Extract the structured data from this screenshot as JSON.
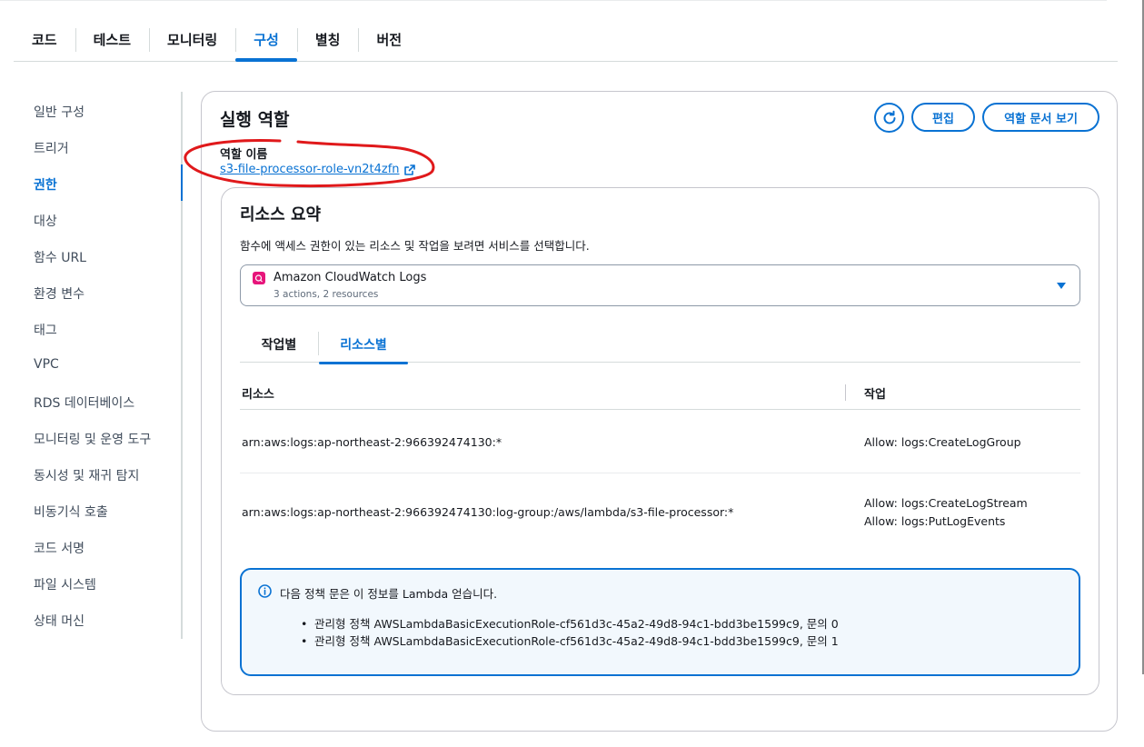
{
  "top_tabs": [
    {
      "label": "코드"
    },
    {
      "label": "테스트"
    },
    {
      "label": "모니터링"
    },
    {
      "label": "구성",
      "active": true
    },
    {
      "label": "별칭"
    },
    {
      "label": "버전"
    }
  ],
  "sidenav": {
    "items": [
      {
        "label": "일반 구성"
      },
      {
        "label": "트리거"
      },
      {
        "label": "권한",
        "active": true
      },
      {
        "label": "대상"
      },
      {
        "label": "함수 URL"
      },
      {
        "label": "환경 변수"
      },
      {
        "label": "태그"
      },
      {
        "label": "VPC"
      },
      {
        "label": "RDS 데이터베이스"
      },
      {
        "label": "모니터링 및 운영 도구"
      },
      {
        "label": "동시성 및 재귀 탐지"
      },
      {
        "label": "비동기식 호출"
      },
      {
        "label": "코드 서명"
      },
      {
        "label": "파일 시스템"
      },
      {
        "label": "상태 머신"
      }
    ]
  },
  "exec_role": {
    "title": "실행 역할",
    "edit_label": "편집",
    "view_doc_label": "역할 문서 보기",
    "role_name_label": "역할 이름",
    "role_name": "s3-file-processor-role-vn2t4zfn"
  },
  "resource_summary": {
    "title": "리소스 요약",
    "description": "함수에 액세스 권한이 있는 리소스 및 작업을 보려면 서비스를 선택합니다.",
    "service": {
      "name": "Amazon CloudWatch Logs",
      "sub": "3 actions, 2 resources"
    },
    "tabs": [
      {
        "label": "작업별"
      },
      {
        "label": "리소스별",
        "active": true
      }
    ],
    "table": {
      "headers": {
        "resource": "리소스",
        "action": "작업"
      },
      "rows": [
        {
          "resource": "arn:aws:logs:ap-northeast-2:966392474130:*",
          "actions": [
            "Allow: logs:CreateLogGroup"
          ]
        },
        {
          "resource": "arn:aws:logs:ap-northeast-2:966392474130:log-group:/aws/lambda/s3-file-processor:*",
          "actions": [
            "Allow: logs:CreateLogStream",
            "Allow: logs:PutLogEvents"
          ]
        }
      ]
    },
    "info": {
      "title": "다음 정책 문은 이 정보를 Lambda 얻습니다.",
      "items": [
        "관리형 정책 AWSLambdaBasicExecutionRole-cf561d3c-45a2-49d8-94c1-bdd3be1599c9, 문의 0",
        "관리형 정책 AWSLambdaBasicExecutionRole-cf561d3c-45a2-49d8-94c1-bdd3be1599c9, 문의 1"
      ]
    }
  },
  "colors": {
    "accent": "#0972d3",
    "annotation": "#e0191b",
    "service_icon": "#e7157b",
    "info_bg": "#f2f8fd"
  },
  "icons": {
    "refresh": "refresh-icon",
    "external_link": "external-link-icon",
    "caret": "caret-down-icon",
    "info": "info-icon",
    "service": "cloudwatch-logs-icon"
  }
}
